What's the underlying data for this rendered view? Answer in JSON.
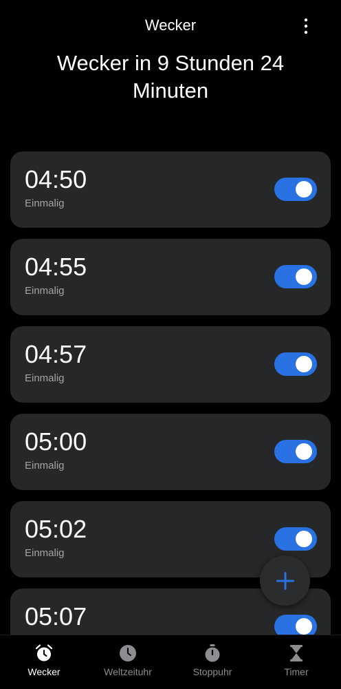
{
  "header": {
    "title": "Wecker",
    "menu_icon": "more-vertical-icon",
    "headline": "Wecker in 9 Stunden 24 Minuten"
  },
  "alarms": [
    {
      "time": "04:50",
      "repeat": "Einmalig",
      "enabled": true
    },
    {
      "time": "04:55",
      "repeat": "Einmalig",
      "enabled": true
    },
    {
      "time": "04:57",
      "repeat": "Einmalig",
      "enabled": true
    },
    {
      "time": "05:00",
      "repeat": "Einmalig",
      "enabled": true
    },
    {
      "time": "05:02",
      "repeat": "Einmalig",
      "enabled": true
    },
    {
      "time": "05:07",
      "repeat": "",
      "enabled": true
    }
  ],
  "fab": {
    "icon": "plus-icon"
  },
  "bottom_nav": {
    "items": [
      {
        "label": "Wecker",
        "icon": "alarm-clock-icon",
        "active": true
      },
      {
        "label": "Weltzeituhr",
        "icon": "clock-icon",
        "active": false
      },
      {
        "label": "Stoppuhr",
        "icon": "stopwatch-icon",
        "active": false
      },
      {
        "label": "Timer",
        "icon": "hourglass-icon",
        "active": false
      }
    ]
  },
  "colors": {
    "background": "#000000",
    "card": "#262728",
    "accent": "#2a72e4",
    "secondary_text": "#a3a4a6",
    "inactive_nav": "#8c8d90"
  }
}
